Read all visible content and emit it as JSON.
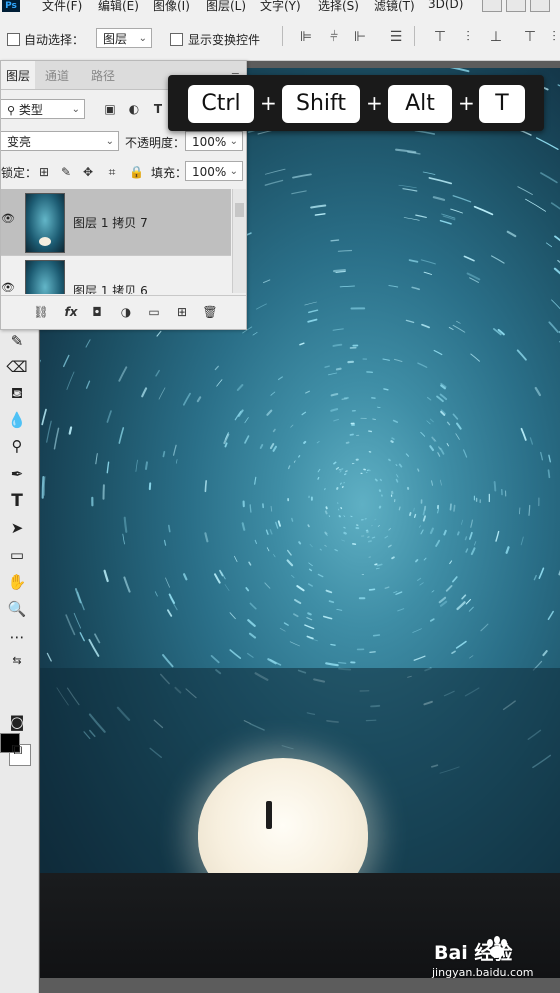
{
  "menubar": {
    "items": [
      "文件(F)",
      "编辑(E)",
      "图像(I)",
      "图层(L)",
      "文字(Y)",
      "选择(S)",
      "滤镜(T)",
      "3D(D)"
    ]
  },
  "options_bar": {
    "auto_select_label": "自动选择：",
    "auto_select_value": "图层",
    "show_transform_label": "显示变换控件"
  },
  "layers_panel": {
    "tabs": [
      "图层",
      "通道",
      "路径"
    ],
    "filter_value": "类型",
    "blend_mode": "变亮",
    "opacity_label": "不透明度：",
    "opacity_value": "100%",
    "lock_label": "锁定：",
    "fill_label": "填充：",
    "fill_value": "100%",
    "layers": [
      {
        "name": "图层 1 拷贝 7",
        "selected": true
      },
      {
        "name": "图层 1 拷贝 6",
        "selected": false
      }
    ],
    "footer_fx": "fx"
  },
  "shortcut_overlay": {
    "keys": [
      "Ctrl",
      "Shift",
      "Alt",
      "T"
    ],
    "separator": "+"
  },
  "watermark": {
    "brand": "Bai  经验",
    "url": "jingyan.baidu.com"
  },
  "colors": {
    "foreground": "#000000",
    "background": "#ffffff",
    "selected_layer": "#bfbfbf"
  }
}
